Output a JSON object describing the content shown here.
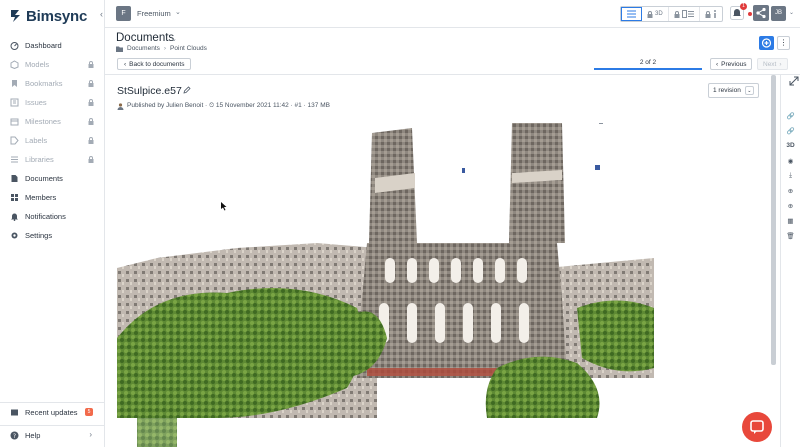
{
  "app": {
    "logo_text": "Bimsync"
  },
  "sidebar": {
    "items": [
      {
        "label": "Dashboard",
        "icon": "dashboard-icon",
        "locked": false
      },
      {
        "label": "Models",
        "icon": "models-icon",
        "locked": true
      },
      {
        "label": "Bookmarks",
        "icon": "bookmark-icon",
        "locked": true
      },
      {
        "label": "Issues",
        "icon": "issues-icon",
        "locked": true
      },
      {
        "label": "Milestones",
        "icon": "milestone-icon",
        "locked": true
      },
      {
        "label": "Labels",
        "icon": "label-icon",
        "locked": true
      },
      {
        "label": "Libraries",
        "icon": "library-icon",
        "locked": true
      },
      {
        "label": "Documents",
        "icon": "document-icon",
        "locked": false
      },
      {
        "label": "Members",
        "icon": "members-icon",
        "locked": false
      },
      {
        "label": "Notifications",
        "icon": "bell-icon",
        "locked": false
      },
      {
        "label": "Settings",
        "icon": "gear-icon",
        "locked": false
      }
    ],
    "recent_updates": "Recent updates",
    "recent_badge": "5",
    "help": "Help"
  },
  "topbar": {
    "project_initial": "F",
    "project_name": "Freemium",
    "view_tabs": [
      {
        "label": "",
        "icon": "list-icon",
        "active": true
      },
      {
        "label": "3D",
        "icon": "lock-icon",
        "active": false
      },
      {
        "label": "",
        "icon": "split-view-icon",
        "active": false
      },
      {
        "label": "",
        "icon": "info-icon",
        "active": false
      }
    ],
    "notification_count": "1",
    "avatar_initials": "JB"
  },
  "document": {
    "title": "Documents",
    "breadcrumb": [
      "Documents",
      "Point Clouds"
    ],
    "back_label": "Back to documents",
    "pager_text": "2 of 2",
    "prev_label": "Previous",
    "next_label": "Next",
    "file_name": "StSulpice.e57",
    "meta": "Published by Julien Benoit · ⏲ 15 November 2021 11:42 · #1 · 137 MB",
    "revision_label": "1 revision"
  },
  "toolbar": {
    "items": [
      "link-icon",
      "link-icon",
      "3D",
      "eye-icon",
      "download-icon",
      "add-circle-icon",
      "add-circle-icon",
      "layout-icon",
      "trash-icon"
    ]
  },
  "colors": {
    "accent": "#2c7be5",
    "chat": "#e8483b",
    "brand": "#1f3b57"
  }
}
